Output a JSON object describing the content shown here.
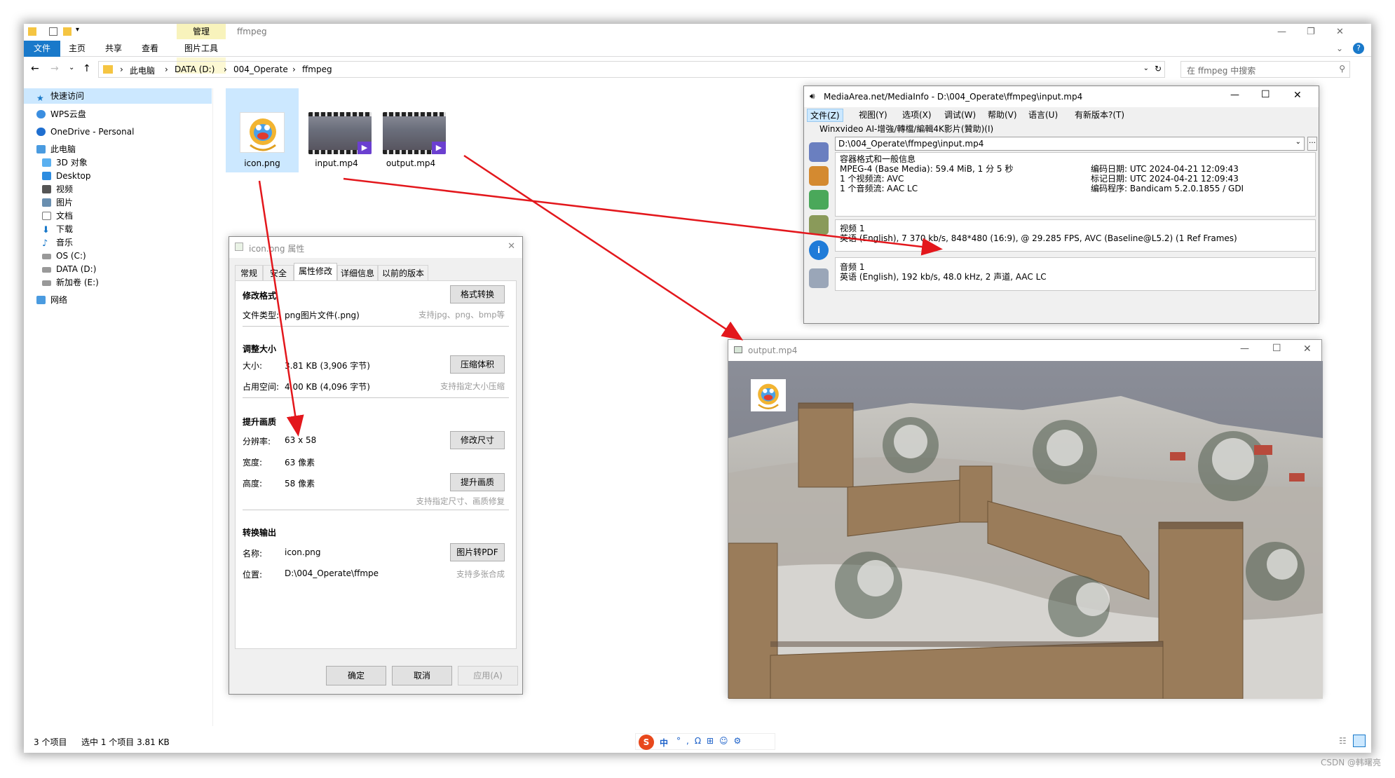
{
  "explorer": {
    "current_folder": "ffmpeg",
    "ribbon_tabs": {
      "file": "文件",
      "home": "主页",
      "share": "共享",
      "view": "查看",
      "manage": "管理",
      "picture_tools": "图片工具"
    },
    "breadcrumb": [
      "此电脑",
      "DATA (D:)",
      "004_Operate",
      "ffmpeg"
    ],
    "search_placeholder": "在 ffmpeg 中搜索",
    "nav": {
      "quick_access": "快速访问",
      "wps": "WPS云盘",
      "onedrive": "OneDrive - Personal",
      "this_pc": "此电脑",
      "objects3d": "3D 对象",
      "desktop": "Desktop",
      "videos": "视频",
      "pictures": "图片",
      "documents": "文档",
      "downloads": "下载",
      "music": "音乐",
      "os_c": "OS (C:)",
      "data_d": "DATA (D:)",
      "new_e": "新加卷 (E:)",
      "network": "网络"
    },
    "files": [
      "icon.png",
      "input.mp4",
      "output.mp4"
    ],
    "status": {
      "count": "3 个项目",
      "selected": "选中 1 个项目 3.81 KB"
    }
  },
  "properties": {
    "title": "icon.png 属性",
    "tabs": [
      "常规",
      "安全",
      "属性修改",
      "详细信息",
      "以前的版本"
    ],
    "s1": {
      "title": "修改格式",
      "type_label": "文件类型:",
      "type_value": "png图片文件(.png)",
      "button": "格式转换",
      "hint": "支持jpg、png、bmp等"
    },
    "s2": {
      "title": "调整大小",
      "size_label": "大小:",
      "size_value": "3.81 KB (3,906 字节)",
      "disk_label": "占用空间:",
      "disk_value": "4.00 KB (4,096 字节)",
      "button": "压缩体积",
      "hint": "支持指定大小压缩"
    },
    "s3": {
      "title": "提升画质",
      "res_label": "分辨率:",
      "res_value": "63 x 58",
      "w_label": "宽度:",
      "w_value": "63 像素",
      "h_label": "高度:",
      "h_value": "58 像素",
      "button1": "修改尺寸",
      "button2": "提升画质",
      "hint": "支持指定尺寸、画质修复"
    },
    "s4": {
      "title": "转换输出",
      "name_label": "名称:",
      "name_value": "icon.png",
      "loc_label": "位置:",
      "loc_value": "D:\\004_Operate\\ffmpe",
      "button": "图片转PDF",
      "hint": "支持多张合成"
    },
    "buttons": {
      "ok": "确定",
      "cancel": "取消",
      "apply": "应用(A)"
    }
  },
  "mediainfo": {
    "title": "MediaArea.net/MediaInfo - D:\\004_Operate\\ffmpeg\\input.mp4",
    "menu": [
      "文件(Z)",
      "视图(Y)",
      "选项(X)",
      "调试(W)",
      "帮助(V)",
      "语言(U)",
      "有新版本?(T)"
    ],
    "promo": "Winxvideo AI-增強/轉檔/編輯4K影片(贊助)(I)",
    "path": "D:\\004_Operate\\ffmpeg\\input.mp4",
    "general": {
      "title": "容器格式和一般信息",
      "l1": "MPEG-4 (Base Media): 59.4 MiB, 1 分 5 秒",
      "l2": "1 个视频流: AVC",
      "l3": "1 个音频流: AAC LC",
      "r1": "编码日期: UTC 2024-04-21 12:09:43",
      "r2": "标记日期: UTC 2024-04-21 12:09:43",
      "r3": "编码程序: Bandicam 5.2.0.1855 / GDI"
    },
    "video": {
      "title": "视频 1",
      "line": "英语 (English), 7 370 kb/s, 848*480 (16:9), @ 29.285 FPS, AVC (Baseline@L5.2) (1 Ref Frames)"
    },
    "audio": {
      "title": "音频 1",
      "line": "英语 (English), 192 kb/s, 48.0 kHz, 2 声道, AAC LC"
    }
  },
  "player": {
    "title": "output.mp4"
  },
  "taskbar": {
    "ime": "中"
  },
  "watermark": "CSDN @韩曙亮"
}
